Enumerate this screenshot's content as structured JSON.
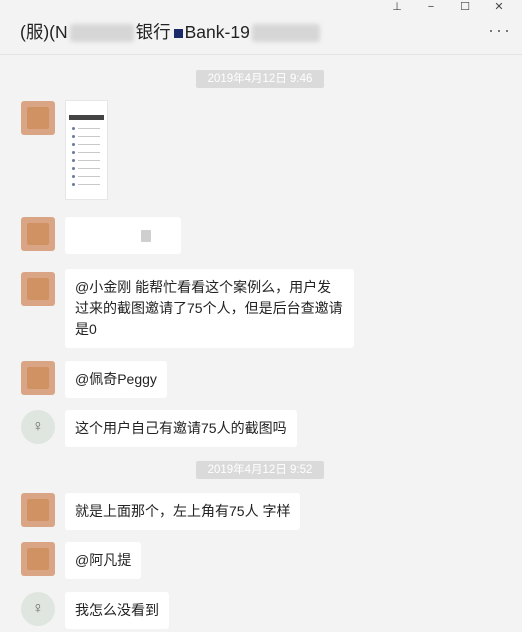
{
  "window": {
    "pin_icon": "pin-icon",
    "min_glyph": "−",
    "max_glyph": "☐",
    "close_glyph": "✕"
  },
  "header": {
    "title_prefix": "(服)(N",
    "title_mid": "银行",
    "title_suffix": "Bank-19",
    "more_glyph": "···"
  },
  "timestamps": [
    "2019年4月12日 9:46",
    "2019年4月12日 9:52"
  ],
  "messages": [
    {
      "type": "image-thumb"
    },
    {
      "type": "image-loading"
    },
    {
      "text": "@小金刚 能帮忙看看这个案例么，用户发过来的截图邀请了75个人，但是后台查邀请是0"
    },
    {
      "text": "@佩奇Peggy"
    },
    {
      "text": "这个用户自己有邀请75人的截图吗"
    },
    {
      "text": "就是上面那个，左上角有75人 字样"
    },
    {
      "text": "@阿凡提"
    },
    {
      "text": "我怎么没看到"
    }
  ],
  "colors": {
    "background": "#f3f3f3",
    "bubble": "#ffffff",
    "timestamp_bg": "#dadada",
    "avatar_orange": "#d9a584"
  }
}
